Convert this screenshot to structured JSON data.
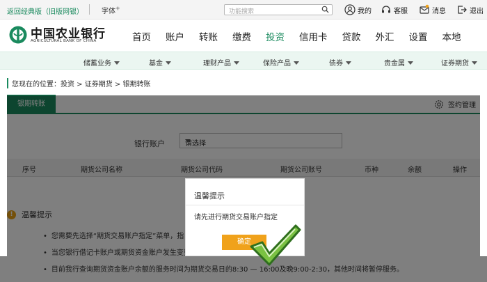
{
  "topbar": {
    "classic_link": "返回经典版（旧版网银）",
    "font_label": "字体",
    "font_plus": "+",
    "search_placeholder": "功能搜索",
    "tools": [
      {
        "label": "我的",
        "icon": "user-icon"
      },
      {
        "label": "客服",
        "icon": "headset-icon"
      },
      {
        "label": "消息",
        "icon": "message-icon"
      },
      {
        "label": "退出",
        "icon": "logout-icon"
      }
    ]
  },
  "header": {
    "brand_cn": "中国农业银行",
    "brand_en": "AGRICULTURAL BANK OF CHINA",
    "nav": [
      "首页",
      "账户",
      "转账",
      "缴费",
      "投资",
      "信用卡",
      "贷款",
      "外汇",
      "设置",
      "本地"
    ],
    "active_nav": "投资"
  },
  "subnav": [
    "储蓄业务",
    "基金",
    "理财产品",
    "保险产品",
    "债券",
    "贵金属",
    "证券期货"
  ],
  "breadcrumb": "您现在的位置：投资 > 证券期货 > 银期转账",
  "tab": {
    "label": "银期转账",
    "sign_label": "签约管理"
  },
  "form": {
    "bank_account_label": "银行账户",
    "select_value": "请选择"
  },
  "table": {
    "headers": [
      "序号",
      "期货公司名称",
      "期货公司代码",
      "期货公司账号",
      "币种",
      "余额",
      "操作"
    ]
  },
  "tips": {
    "title": "温馨提示",
    "items": [
      "您需要先选择“期货交易账户指定”菜单，指",
      "当您银行借记卡账户或期货资金账户发生变更",
      "目前我行查询期货资金账户余额的服务时间为期货交易日的8:30 — 16:00及晚9:00-2:30，其他时间将暂停服务。"
    ]
  },
  "modal": {
    "title": "温馨提示",
    "message": "请先进行期货交易账户指定",
    "ok_label": "确定"
  },
  "colors": {
    "brand_green": "#1a8a5e",
    "ok_orange": "#f0a21b"
  }
}
